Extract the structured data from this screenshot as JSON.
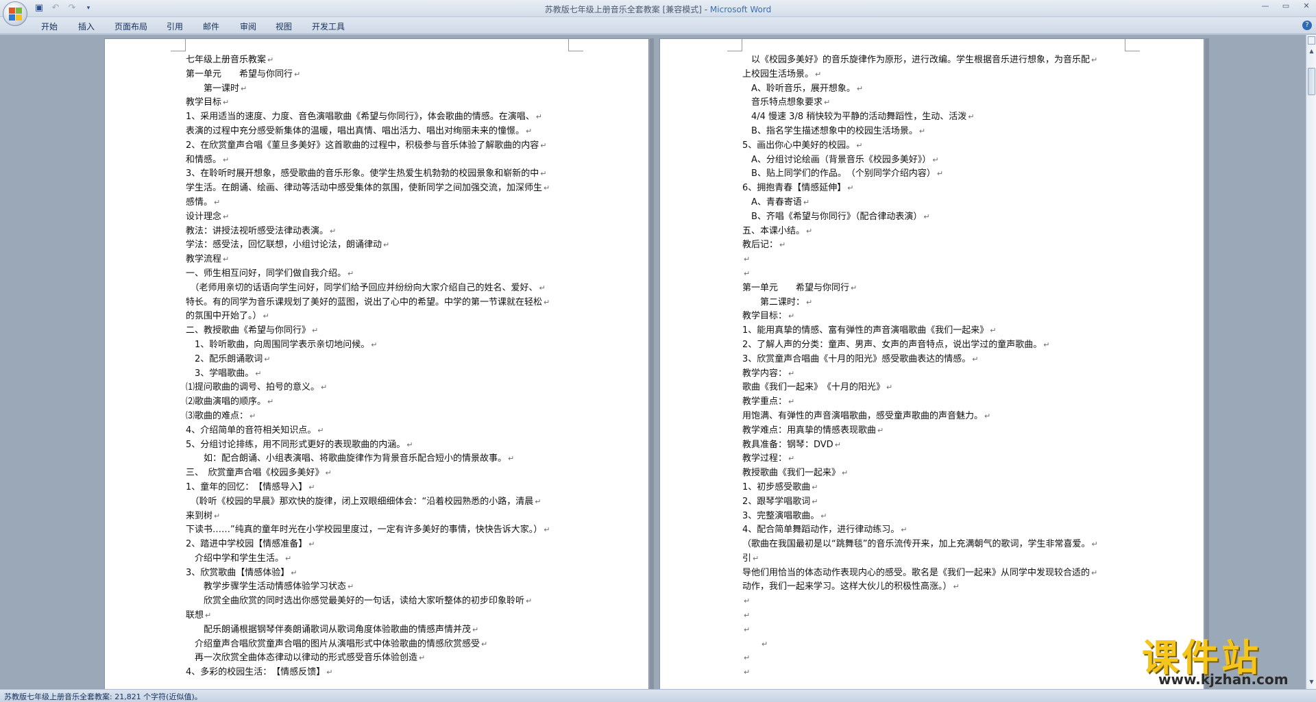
{
  "window": {
    "title_doc": "苏教版七年级上册音乐全套教案 [兼容模式] - ",
    "title_app": "Microsoft Word"
  },
  "tabs": [
    "开始",
    "插入",
    "页面布局",
    "引用",
    "邮件",
    "审阅",
    "视图",
    "开发工具"
  ],
  "page1_lines": [
    "七年级上册音乐教案",
    "第一单元　　希望与你同行",
    "　　第一课时",
    "教学目标",
    "1、采用适当的速度、力度、音色演唱歌曲《希望与你同行》，体会歌曲的情感。在演唱、",
    "表演的过程中充分感受新集体的温暖，唱出真情、唱出活力、唱出对绚丽未来的憧憬。",
    "2、在欣赏童声合唱《菫旦多美好》这首歌曲的过程中，积极参与音乐体验了解歌曲的内容",
    "和情感。",
    "3、在聆听时展开想象，感受歌曲的音乐形象。使学生热爱生机勃勃的校园景象和崭新的中",
    "学生活。在朗诵、绘画、律动等活动中感受集体的氛围，使新同学之间加强交流，加深师生",
    "感情。",
    "设计理念",
    "教法：讲授法视听感受法律动表演。",
    "学法：感受法，回忆联想，小组讨论法，朗诵律动",
    "教学流程",
    "一、师生相互问好，同学们做自我介绍。",
    "　（老师用亲切的话语向学生问好，同学们给予回应并纷纷向大家介绍自己的姓名、爱好、",
    "特长。有的同学为音乐课规划了美好的蓝图，说出了心中的希望。中学的第一节课就在轻松",
    "的氛围中开始了。）",
    "二、教授歌曲《希望与你同行》",
    "　1、聆听歌曲，向周围同学表示亲切地问候。",
    "　2、配乐朗诵歌词",
    "　3、学唱歌曲。",
    "⑴提问歌曲的调号、拍号的意义。",
    "⑵歌曲演唱的顺序。",
    "⑶歌曲的难点：",
    "4、介绍简单的音符相关知识点。",
    "5、分组讨论排练，用不同形式更好的表现歌曲的内涵。",
    "　　如：配合朗诵、小组表演唱、将歌曲旋律作为背景音乐配合短小的情景故事。",
    "三、　欣赏童声合唱《校园多美好》",
    " 1、童年的回忆：　【情感导入】",
    "　（聆听《校园的早晨》那欢快的旋律，闭上双眼细细体会：“沿着校园熟悉的小路，清晨",
    "来到树",
    "下读书……”纯真的童年时光在小学校园里度过，一定有许多美好的事情，快快告诉大家。）",
    "2、踏进中学校园【情感准备】",
    "　介绍中学和学生生活。",
    "3、欣赏歌曲【情感体验】",
    "　　教学步骤学生活动情感体验学习状态",
    "　　欣赏全曲欣赏的同时选出你感觉最美好的一句话，读给大家听整体的初步印象聆听",
    "联想",
    "　　配乐朗诵根据钢琴伴奏朗诵歌词从歌词角度体验歌曲的情感声情并茂",
    "　介绍童声合唱欣赏童声合唱的图片从演唱形式中体验歌曲的情感欣赏感受",
    "　再一次欣赏全曲体态律动以律动的形式感受音乐体验创造",
    "4、多彩的校园生活：　【情感反馈】"
  ],
  "page2_lines": [
    "　以《校园多美好》的音乐旋律作为原形，进行改编。学生根据音乐进行想象，为音乐配",
    "上校园生活场景。",
    "　A、聆听音乐，展开想象。",
    "　音乐特点想象要求",
    "　4/4 慢速 3/8 稍快较为平静的活动舞蹈性，生动、活泼",
    "　B、指名学生描述想象中的校园生活场景。",
    "5、画出你心中美好的校园。",
    "　A、分组讨论绘画（背景音乐《校园多美好》）",
    "　B、贴上同学们的作品。　（个别同学介绍内容）",
    "6、拥抱青春【情感延伸】",
    "　A、青春寄语",
    "　B、齐唱《希望与你同行》（配合律动表演）",
    "五、本课小结。",
    "教后记：",
    "",
    "",
    "第一单元　　希望与你同行",
    "　　第二课时：",
    "教学目标：",
    "1、能用真挚的情感、富有弹性的声音演唱歌曲《我们一起来》",
    "2、了解人声的分类：童声、男声、女声的声音特点，说出学过的童声歌曲。",
    "3、欣赏童声合唱曲《十月的阳光》感受歌曲表达的情感。",
    "教学内容：",
    "歌曲《我们一起来》　《十月的阳光》",
    "教学重点：",
    "用饱满、有弹性的声音演唱歌曲，感受童声歌曲的声音魅力。",
    "教学难点：用真挚的情感表现歌曲",
    "教具准备：钢琴：DVD",
    "教学过程：",
    "教授歌曲《我们一起来》",
    "1、初步感受歌曲",
    "2、跟琴学唱歌词",
    "3、完整演唱歌曲。",
    "4、配合简单舞蹈动作，进行律动练习。",
    "（歌曲在我国最初是以“跳舞毯”的音乐流传开来，加上充满朝气的歌词，学生非常喜爱。",
    "引",
    "导他们用恰当的体态动作表现内心的感受。歌名是《我们一起来》从同学中发现较合适的",
    "动作，我们一起来学习。这样大伙儿的积极性高涨。）",
    "",
    "",
    "",
    "　　",
    "",
    ""
  ],
  "status": "苏教版七年级上册音乐全套教案: 21,821 个字符(近似值)。",
  "watermark": {
    "brand": "课件站",
    "url": "www.kjzhan.com"
  },
  "colors": {
    "accent": "#2f6ab6",
    "watermark": "#f4c51a"
  }
}
